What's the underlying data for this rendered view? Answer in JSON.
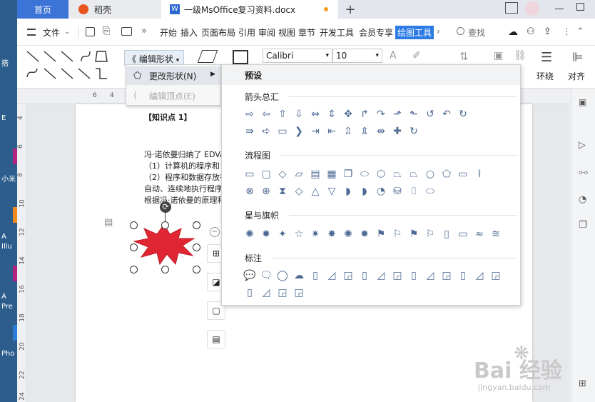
{
  "desktop": {
    "labels": [
      "搭",
      "E",
      "小米",
      "A",
      "Illu",
      "A",
      "Pre",
      "Pho"
    ]
  },
  "tabs": {
    "home": "首页",
    "daoke": "稻壳",
    "doc": "一级MsOffice复习资料.docx",
    "add": "+"
  },
  "menubar": {
    "file": "文件",
    "items": [
      "开始",
      "插入",
      "页面布局",
      "引用",
      "审阅",
      "视图",
      "章节",
      "开发工具",
      "会员专享",
      "绘图工具"
    ],
    "search": "查找"
  },
  "ribbon": {
    "edit_shape": "编辑形状",
    "font_name": "Calibri",
    "font_size": "10",
    "wrap": "环绕",
    "align": "对齐"
  },
  "ruler": {
    "ticks": [
      "6",
      "4",
      "46"
    ],
    "vticks": [
      "4",
      "6",
      "8",
      "10",
      "12",
      "14",
      "16",
      "18",
      "20",
      "22",
      "24"
    ]
  },
  "page": {
    "heading": "【知识点 1】",
    "lines": [
      "冯·诺依曼归纳了 EDVA",
      "（1）计算机的程序和",
      "（2）程序和数据存放在",
      "自动、连续地执行程序",
      "根据冯·诺依曼的原理和"
    ]
  },
  "submenu": {
    "change_shape": "更改形状(N)",
    "edit_points": "编辑顶点(E)"
  },
  "gallery": {
    "header": "预设",
    "sections": [
      "箭头总汇",
      "流程图",
      "星与旗帜",
      "标注"
    ],
    "arrows_row1": [
      "⇨",
      "⇦",
      "⇧",
      "⇩",
      "⇔",
      "⇕",
      "✥",
      "↱",
      "↷",
      "⬏",
      "⬑",
      "↺",
      "↶",
      "↻"
    ],
    "arrows_row2": [
      "⇛",
      "➪",
      "▭",
      "❯",
      "⇥",
      "⇤",
      "⇫",
      "⇭",
      "⇹",
      "✚",
      "↻"
    ],
    "flow_row1": [
      "▭",
      "▢",
      "◇",
      "▱",
      "▤",
      "▦",
      "❐",
      "⬭",
      "⬡",
      "⏢",
      "⏢",
      "○",
      "⬠",
      "▭",
      "⌇"
    ],
    "flow_row2": [
      "⊗",
      "⊕",
      "⧗",
      "◇",
      "△",
      "▽",
      "◗",
      "◗",
      "◔",
      "⛁",
      "⌷",
      "⬭"
    ],
    "stars_row": [
      "✺",
      "✹",
      "✦",
      "☆",
      "✷",
      "✸",
      "✺",
      "✹",
      "⚑",
      "⚐",
      "⚑",
      "⚐",
      "▯",
      "▭",
      "≈",
      "≋"
    ],
    "callouts_row1": [
      "💬",
      "🗨",
      "◯",
      "☁",
      "▯",
      "◿",
      "◲",
      "▯",
      "◿",
      "◲",
      "▯",
      "◿",
      "◲",
      "▯",
      "◿",
      "◲"
    ],
    "callouts_row2": [
      "▯",
      "◿",
      "◲",
      "◲"
    ]
  },
  "watermark": {
    "brand": "Bai 经验",
    "url": "jingyan.baidu.com"
  },
  "colors": {
    "accent": "#2d7be5",
    "home_tab": "#3c73d6",
    "star_fill": "#e02633"
  }
}
